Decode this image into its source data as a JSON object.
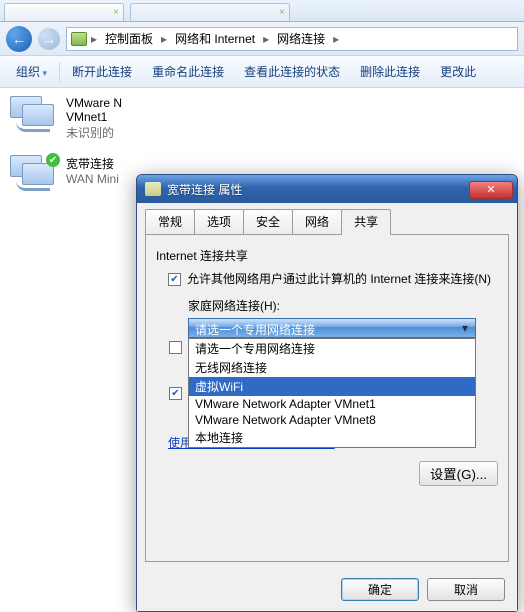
{
  "breadcrumb": {
    "seg1": "控制面板",
    "seg2": "网络和 Internet",
    "seg3": "网络连接"
  },
  "toolbar": {
    "organize": "组织",
    "disconnect": "断开此连接",
    "rename": "重命名此连接",
    "view_status": "查看此连接的状态",
    "delete": "删除此连接",
    "change": "更改此"
  },
  "net_items": [
    {
      "line1": "VMware N",
      "line2": "VMnet1",
      "line3": "未识别的"
    },
    {
      "line1": "宽带连接",
      "line2": "",
      "line3": "WAN Mini"
    }
  ],
  "dialog": {
    "title": "宽带连接 属性",
    "tabs": {
      "general": "常规",
      "options": "选项",
      "security": "安全",
      "network": "网络",
      "sharing": "共享"
    },
    "group_title": "Internet 连接共享",
    "cb_allow": "允许其他网络用户通过此计算机的 Internet 连接来连接(N)",
    "home_label": "家庭网络连接(H):",
    "dd_selected": "请选一个专用网络连接",
    "dd_items": [
      "请选一个专用网络连接",
      "无线网络连接",
      "虚拟WiFi",
      "VMware Network Adapter VMnet1",
      "VMware Network Adapter VMnet8",
      "本地连接"
    ],
    "link": "使用 ICS （Internet 连接共享）",
    "settings_btn": "设置(G)...",
    "ok": "确定",
    "cancel": "取消"
  }
}
